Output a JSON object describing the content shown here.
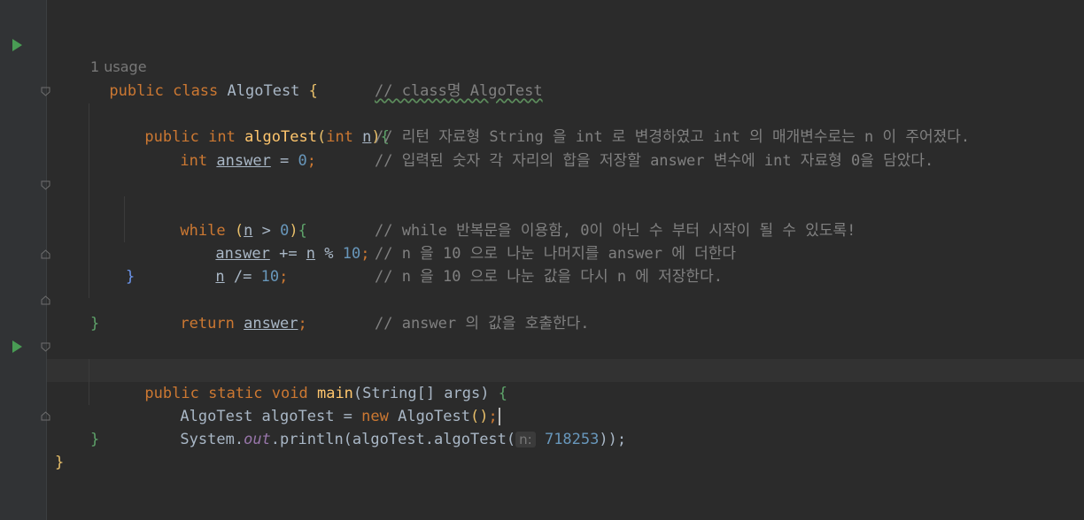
{
  "lines": {
    "l1": {
      "kw1": "public",
      "kw2": "class",
      "cls": "AlgoTest",
      "brace": "{",
      "comment": "// class명 AlgoTest"
    },
    "usage": "1 usage",
    "l2": {
      "kw1": "public",
      "type": "int",
      "fn": "algoTest",
      "paren_open": "(",
      "ptype": "int",
      "pname": "n",
      "paren_close": ")",
      "brace": "{",
      "comment": "// 리턴 자료형 String 을 int 로 변경하였고 int 의 매개변수로는 n 이 주어졌다."
    },
    "l3": {
      "type": "int",
      "var": "answer",
      "rest1": " = ",
      "num": "0",
      "semi": ";",
      "comment": "// 입력된 숫자 각 자리의 합을 저장할 answer 변수에 int 자료형 0을 담았다."
    },
    "l4": {
      "kw": "while",
      "paren_open": "(",
      "var": "n",
      "op": " > ",
      "num": "0",
      "paren_close": ")",
      "brace": "{",
      "comment": "// while 반복문을 이용함, 0이 아닌 수 부터 시작이 될 수 있도록!"
    },
    "l5": {
      "var": "answer",
      "op": " += ",
      "var2": "n",
      "op2": " % ",
      "num": "10",
      "semi": ";",
      "comment": "// n 을 10 으로 나눈 나머지를 answer 에 더한다"
    },
    "l6": {
      "var": "n",
      "op": " /= ",
      "num": "10",
      "semi": ";",
      "comment": "// n 을 10 으로 나눈 값을 다시 n 에 저장한다."
    },
    "l7": {
      "brace": "}"
    },
    "l8": {
      "kw": "return",
      "var": "answer",
      "semi": ";",
      "comment": "// answer 의 값을 호출한다."
    },
    "l9": {
      "brace": "}"
    },
    "l10": {
      "kw1": "public",
      "kw2": "static",
      "kw3": "void",
      "fn": "main",
      "paren_open": "(",
      "ptype": "String[]",
      "pname": " args",
      "paren_close": ")",
      "brace": "{"
    },
    "l11": {
      "type": "AlgoTest",
      "var": " algoTest = ",
      "kw": "new",
      "cls": " AlgoTest",
      "parens": "()",
      "semi": ";"
    },
    "l12": {
      "cls": "System.",
      "field": "out",
      "rest": ".println(algoTest.algoTest(",
      "hint_name": "n:",
      "hint_value": "718253",
      "close": "));"
    },
    "l13": {
      "brace": "}"
    },
    "l14": {
      "brace": "}"
    }
  },
  "icons": [
    "run-icon",
    "fold-icon"
  ],
  "colors": {
    "background": "#2b2b2b",
    "keyword": "#cc7832",
    "function": "#ffc66d",
    "number": "#6897bb",
    "comment": "#808080",
    "text": "#a9b7c6",
    "run": "#499c54"
  }
}
